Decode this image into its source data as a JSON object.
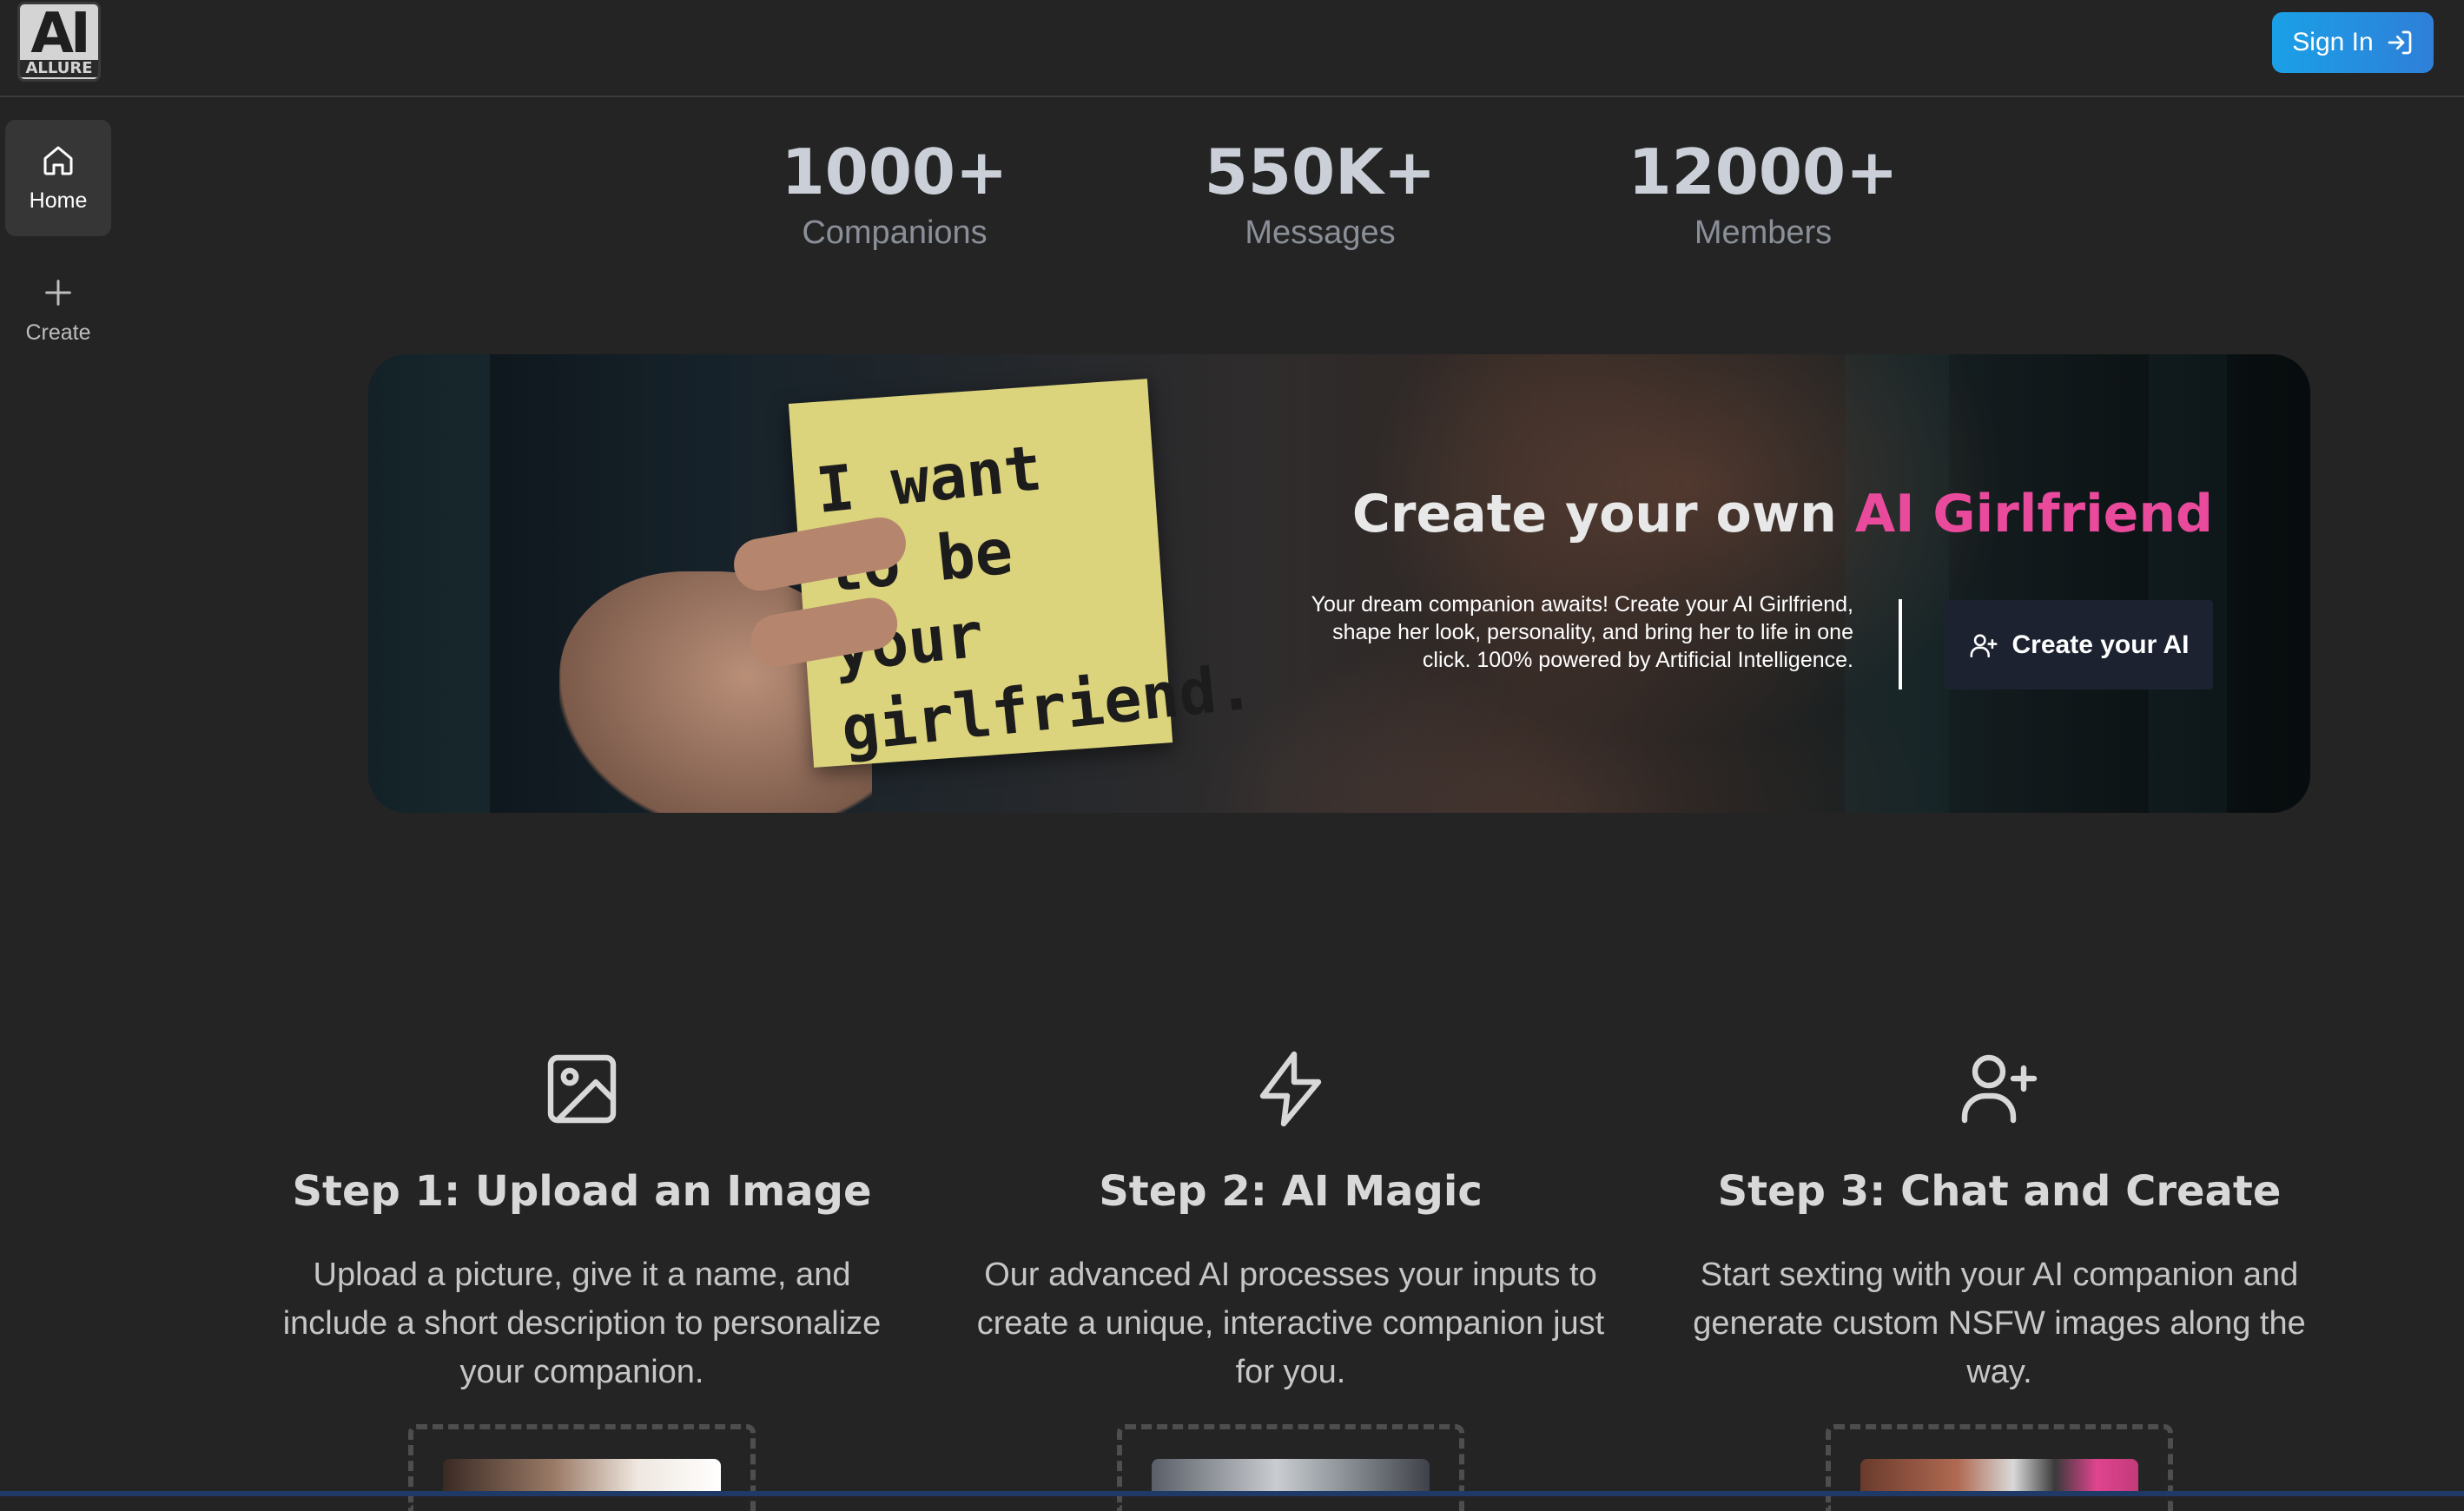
{
  "header": {
    "logo_mark": "AI",
    "logo_word": "ALLURE",
    "signin_label": "Sign In"
  },
  "sidebar": {
    "items": [
      {
        "label": "Home",
        "icon": "home-icon",
        "active": true
      },
      {
        "label": "Create",
        "icon": "plus-icon",
        "active": false
      }
    ]
  },
  "stats": [
    {
      "value": "1000+",
      "label": "Companions"
    },
    {
      "value": "550K+",
      "label": "Messages"
    },
    {
      "value": "12000+",
      "label": "Members"
    }
  ],
  "banner": {
    "note_text": "I want to be your girlfriend.",
    "title_prefix": "Create your own ",
    "title_accent": "AI Girlfriend",
    "description": "Your dream companion awaits! Create your AI Girlfriend, shape her look, personality, and bring her to life in one click. 100% powered by Artificial Intelligence.",
    "cta_label": "Create your AI",
    "cta_icon": "user-plus-icon"
  },
  "steps": [
    {
      "icon": "image-icon",
      "title": "Step 1: Upload an Image",
      "text": "Upload a picture, give it a name, and include a short description to personalize your companion."
    },
    {
      "icon": "lightning-icon",
      "title": "Step 2: AI Magic",
      "text": "Our advanced AI processes your inputs to create a unique, interactive companion just for you."
    },
    {
      "icon": "user-plus-icon",
      "title": "Step 3: Chat and Create",
      "text": "Start sexting with your AI companion and generate custom NSFW images along the way."
    }
  ],
  "colors": {
    "background": "#242424",
    "accent_pink": "#ea4a9b",
    "signin_blue": "#1aa0e6",
    "cta_dark": "#1c2230"
  }
}
